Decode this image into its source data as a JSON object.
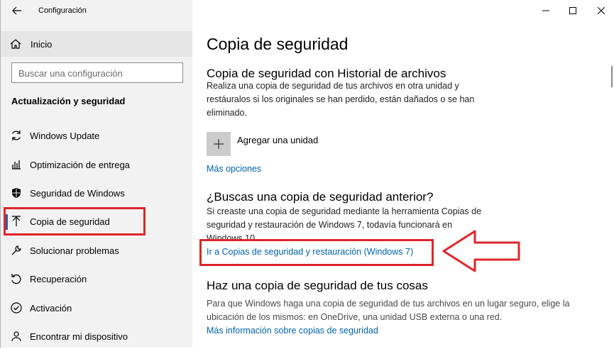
{
  "window": {
    "title": "Configuración",
    "back_icon": "arrow-left-icon",
    "controls": [
      "minimize-icon",
      "maximize-icon",
      "close-icon"
    ]
  },
  "sidebar": {
    "home_label": "Inicio",
    "search_placeholder": "Buscar una configuración",
    "section_title": "Actualización y seguridad",
    "items": [
      {
        "label": "Windows Update",
        "icon": "sync-icon"
      },
      {
        "label": "Optimización de entrega",
        "icon": "delivery-optimization-icon"
      },
      {
        "label": "Seguridad de Windows",
        "icon": "shield-icon"
      },
      {
        "label": "Copia de seguridad",
        "icon": "upload-arrow-icon",
        "selected": true
      },
      {
        "label": "Solucionar problemas",
        "icon": "wrench-icon"
      },
      {
        "label": "Recuperación",
        "icon": "recovery-icon"
      },
      {
        "label": "Activación",
        "icon": "check-circle-icon"
      },
      {
        "label": "Encontrar mi dispositivo",
        "icon": "person-pin-icon"
      }
    ]
  },
  "main": {
    "title": "Copia de seguridad",
    "history": {
      "heading": "Copia de seguridad con Historial de archivos",
      "description": "Realiza una copia de seguridad de tus archivos en otra unidad y restáuralos si los originales se han perdido, están dañados o se han eliminado.",
      "add_drive_label": "Agregar una unidad",
      "more_options": "Más opciones"
    },
    "older": {
      "heading": "¿Buscas una copia de seguridad anterior?",
      "description": "Si creaste una copia de seguridad mediante la herramienta Copias de seguridad y restauración de Windows 7, todavía funcionará en Windows 10.",
      "link": "Ir a Copias de seguridad y restauración (Windows 7)"
    },
    "things": {
      "heading": "Haz una copia de seguridad de tus cosas",
      "description": "Para que Windows haga una copia de seguridad de tus archivos en un lugar seguro, elige la ubicación de los mismos: en OneDrive, una unidad USB externa o una red.",
      "link": "Más información sobre copias de seguridad"
    }
  },
  "colors": {
    "accent": "#0063b1",
    "annotation_red": "#e0252b",
    "sidebar_bg": "#f2f2f2"
  }
}
